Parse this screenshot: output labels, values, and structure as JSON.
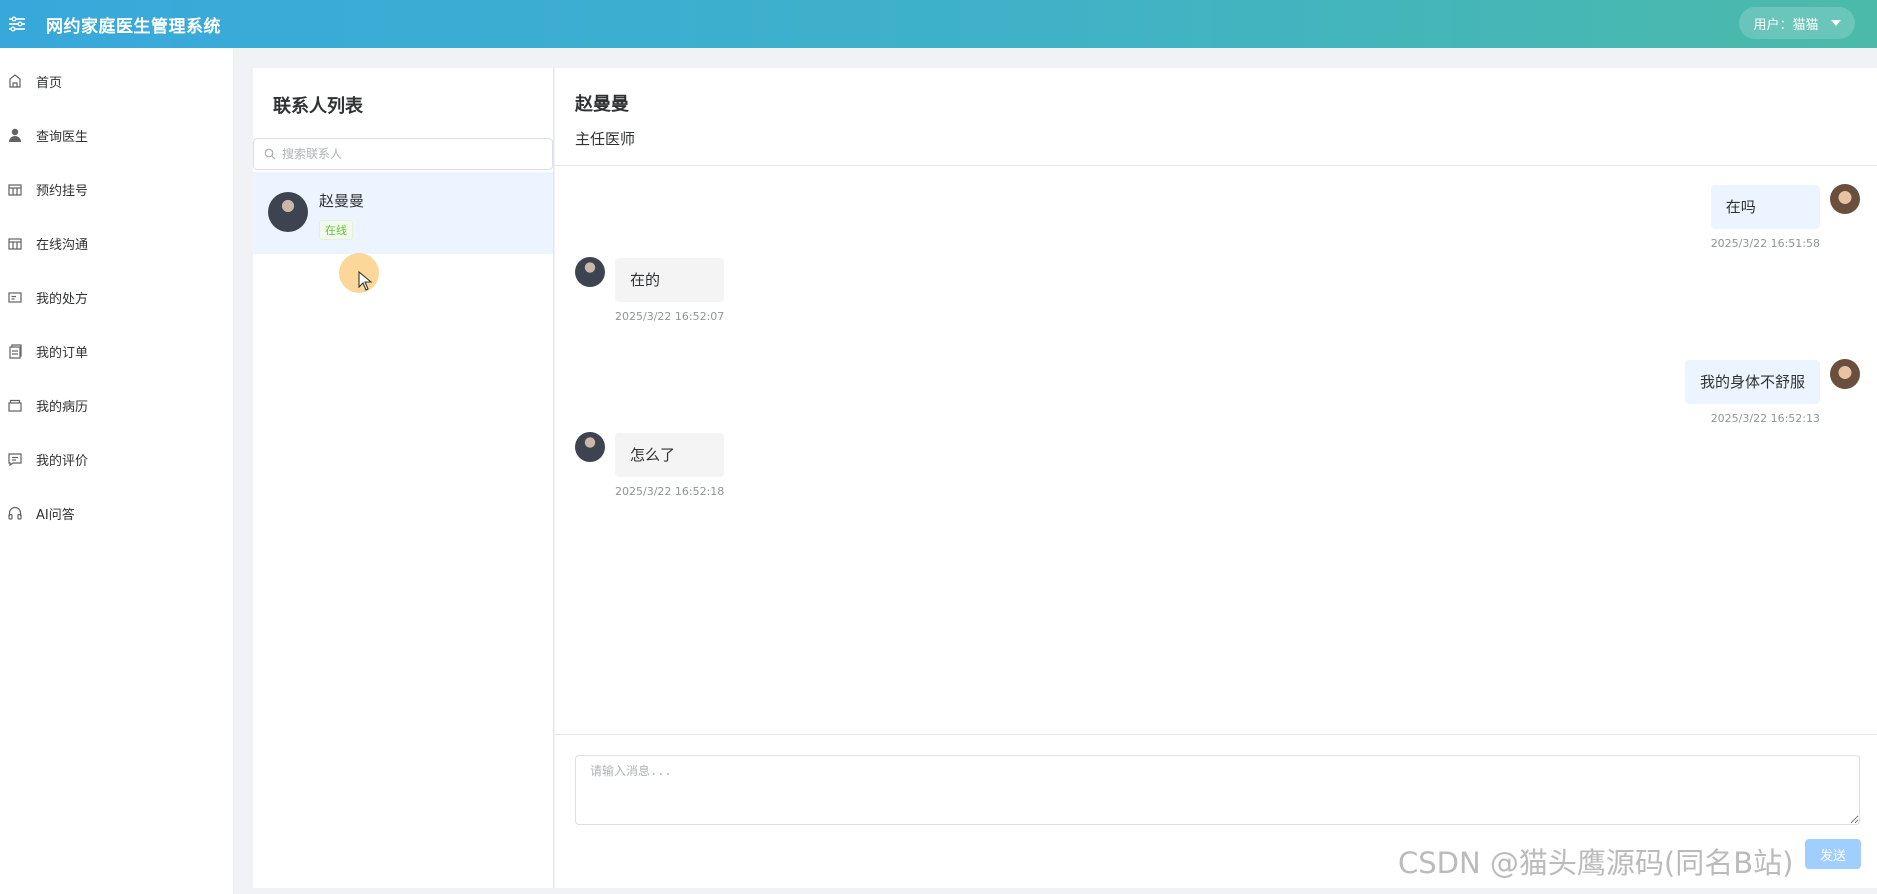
{
  "header": {
    "app_title": "网约家庭医生管理系统",
    "user_label": "用户：猫猫",
    "accent_color": "#38a8dc"
  },
  "sidebar": {
    "items": [
      {
        "label": "首页",
        "icon": "home-icon"
      },
      {
        "label": "查询医生",
        "icon": "user-icon"
      },
      {
        "label": "预约挂号",
        "icon": "calendar-icon"
      },
      {
        "label": "在线沟通",
        "icon": "chat-icon"
      },
      {
        "label": "我的处方",
        "icon": "prescription-icon"
      },
      {
        "label": "我的订单",
        "icon": "order-icon"
      },
      {
        "label": "我的病历",
        "icon": "folder-icon"
      },
      {
        "label": "我的评价",
        "icon": "comment-icon"
      },
      {
        "label": "AI问答",
        "icon": "headset-icon"
      }
    ]
  },
  "contacts": {
    "title": "联系人列表",
    "search_placeholder": "搜索联系人",
    "list": [
      {
        "name": "赵曼曼",
        "status": "在线"
      }
    ]
  },
  "chat": {
    "contact_name": "赵曼曼",
    "contact_title": "主任医师",
    "messages": [
      {
        "from": "self",
        "text": "在吗",
        "time": "2025/3/22 16:51:58"
      },
      {
        "from": "other",
        "text": "在的",
        "time": "2025/3/22 16:52:07"
      },
      {
        "from": "self",
        "text": "我的身体不舒服",
        "time": "2025/3/22 16:52:13"
      },
      {
        "from": "other",
        "text": "怎么了",
        "time": "2025/3/22 16:52:18"
      }
    ],
    "input_placeholder": "请输入消息...",
    "send_label": "发送"
  },
  "watermark": "CSDN @猫头鹰源码(同名B站)"
}
